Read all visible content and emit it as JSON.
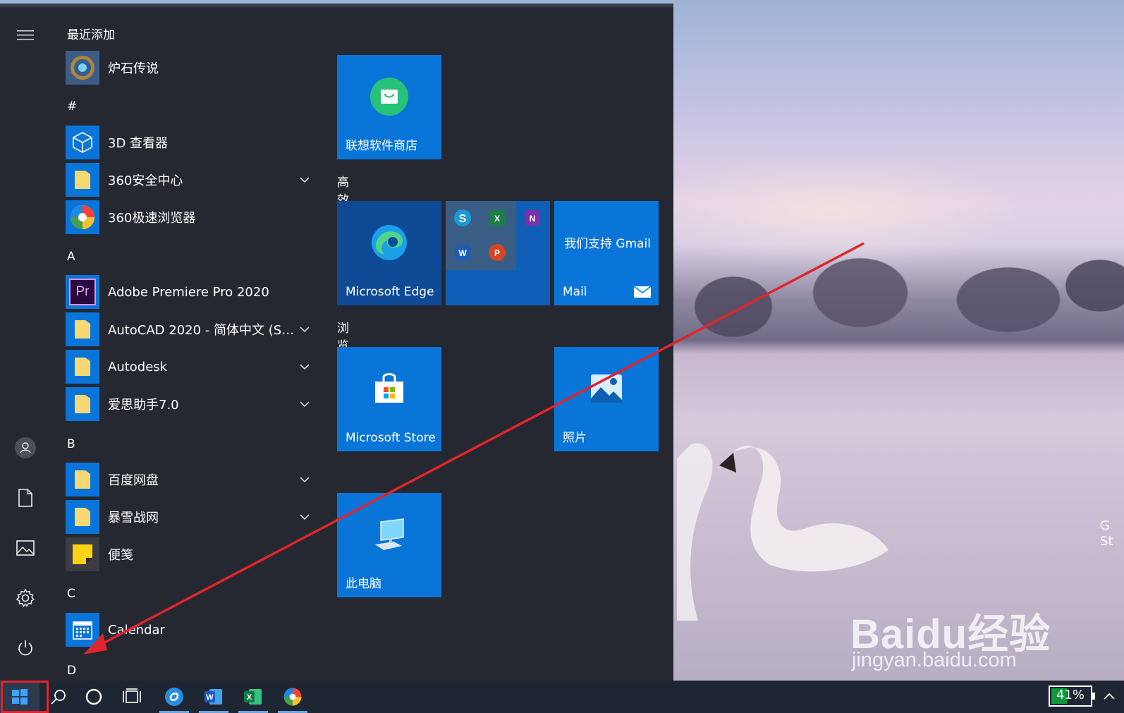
{
  "start_menu": {
    "sections": {
      "recent": "最近添加",
      "hash": "#",
      "a": "A",
      "b": "B",
      "c": "C",
      "d": "D"
    },
    "apps": {
      "hearthstone": "炉石传说",
      "viewer3d": "3D 查看器",
      "sec360": "360安全中心",
      "browser360": "360极速浏览器",
      "premiere": "Adobe Premiere Pro 2020",
      "autocad": "AutoCAD 2020 - 简体中文 (Si...",
      "autodesk": "Autodesk",
      "aisi": "爱思助手7.0",
      "baidupan": "百度网盘",
      "battlenet": "暴雪战网",
      "sticky": "便笺",
      "calendar": "Calendar"
    },
    "tiles": {
      "lenovo_store": "联想软件商店",
      "group_work": "高效工作",
      "edge": "Microsoft Edge",
      "mail_promo": "我们支持 Gmail",
      "mail": "Mail",
      "group_browse": "浏览",
      "store": "Microsoft Store",
      "photos": "照片",
      "this_pc": "此电脑"
    },
    "premiere_abbr": "Pr"
  },
  "taskbar": {
    "battery_level": 0.41,
    "battery_text": "41%"
  },
  "desktop": {
    "side_text_1": "G",
    "side_text_2": "St",
    "watermark_main": "Baidu经验",
    "watermark_sub": "jingyan.baidu.com"
  },
  "colors": {
    "tile_blue": "#0a75d8",
    "menu_bg": "#252831",
    "annotation_red": "#e0242b",
    "battery_green": "#0c9a3a"
  }
}
